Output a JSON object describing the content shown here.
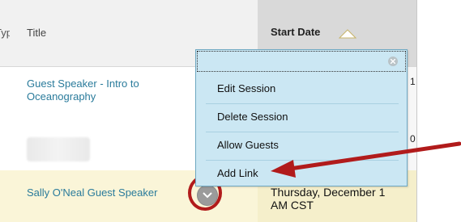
{
  "table": {
    "header": {
      "cut_column_label": "Type",
      "title_label": "Title",
      "start_date_label": "Start Date"
    },
    "rows": [
      {
        "title": "Guest Speaker - Intro to Oceanography",
        "date_peek": "1"
      },
      {
        "title": "",
        "date_peek": "0"
      },
      {
        "title": "Sally O'Neal Guest Speaker",
        "start_date": "Thursday, December 1",
        "start_date_line2": "AM CST"
      }
    ]
  },
  "context_menu": {
    "items": [
      "Edit Session",
      "Delete Session",
      "Allow Guests",
      "Add Link"
    ]
  },
  "colors": {
    "link": "#2a7b9b",
    "menu_bg": "#cbe7f3",
    "highlight_row": "#faf5d8",
    "annotation_red": "#b11b1b"
  },
  "icons": {
    "sort": "sort-ascending-icon",
    "menu_toggle": "chevron-down-icon",
    "close": "close-icon"
  }
}
